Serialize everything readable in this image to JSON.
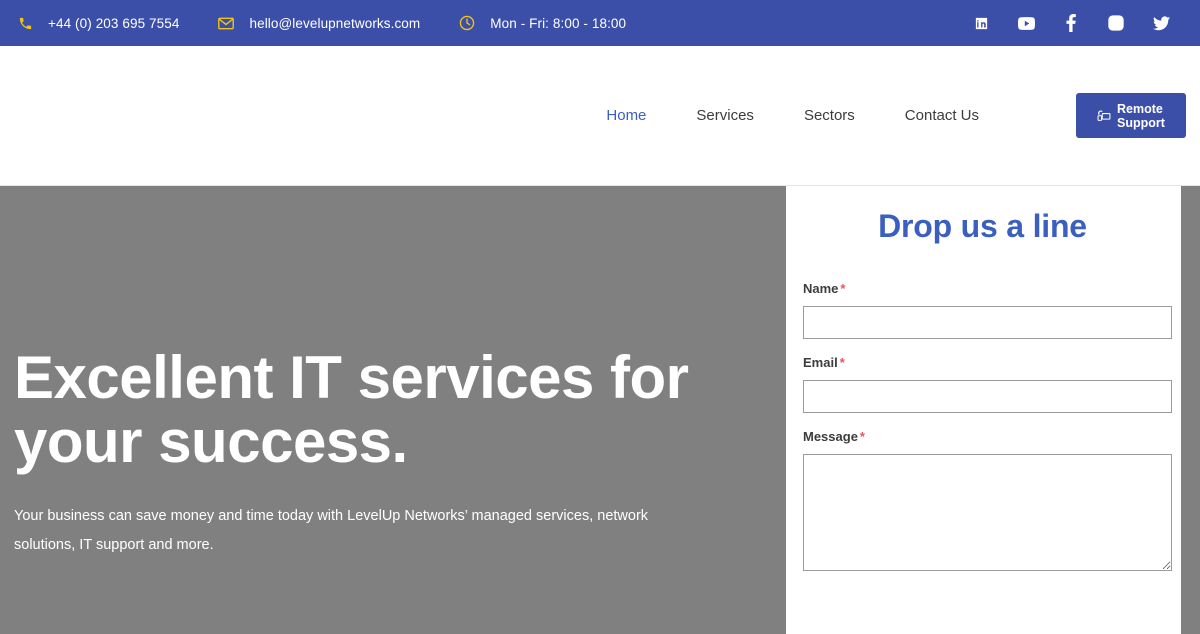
{
  "topbar": {
    "background_color": "#3b4fa8",
    "icon_color": "#f0c419",
    "contacts": [
      {
        "icon": "phone-icon",
        "text": "+44 (0) 203 695 7554"
      },
      {
        "icon": "envelope-icon",
        "text": "hello@levelupnetworks.com"
      },
      {
        "icon": "clock-icon",
        "text": "Mon - Fri: 8:00 - 18:00"
      }
    ],
    "social": [
      {
        "icon": "linkedin-icon",
        "label": "LinkedIn"
      },
      {
        "icon": "youtube-icon",
        "label": "YouTube"
      },
      {
        "icon": "facebook-icon",
        "label": "Facebook"
      },
      {
        "icon": "instagram-icon",
        "label": "Instagram"
      },
      {
        "icon": "twitter-icon",
        "label": "Twitter"
      }
    ]
  },
  "header": {
    "nav": [
      {
        "label": "Home",
        "active": true
      },
      {
        "label": "Services",
        "active": false
      },
      {
        "label": "Sectors",
        "active": false
      },
      {
        "label": "Contact Us",
        "active": false
      }
    ],
    "remote_support": {
      "line1": "Remote",
      "line2": "Support",
      "icon": "remote-desktop-icon",
      "background_color": "#3b4fa8"
    }
  },
  "hero": {
    "background_color": "#808080",
    "title": "Excellent IT services for your success.",
    "subtitle": "Your business can save money and time today with LevelUp Networks’ managed services, network solutions, IT support and more."
  },
  "form": {
    "title": "Drop us a line",
    "title_color": "#3b5fc0",
    "required_marker": "*",
    "fields": [
      {
        "label": "Name",
        "required": true,
        "type": "text",
        "value": "",
        "placeholder": ""
      },
      {
        "label": "Email",
        "required": true,
        "type": "text",
        "value": "",
        "placeholder": ""
      },
      {
        "label": "Message",
        "required": true,
        "type": "textarea",
        "value": "",
        "placeholder": ""
      }
    ]
  }
}
